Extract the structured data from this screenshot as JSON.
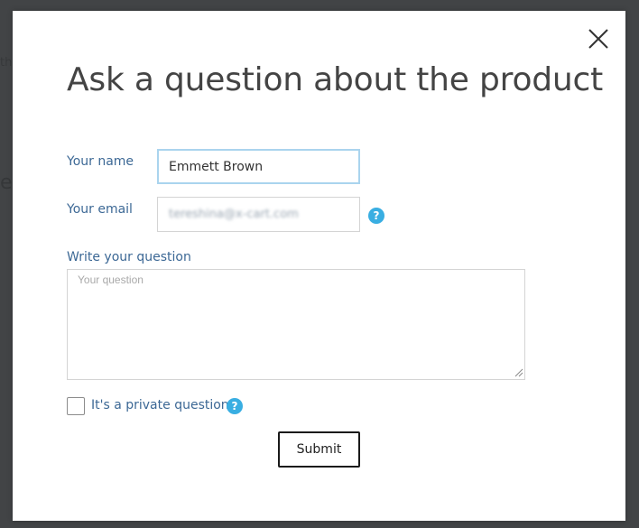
{
  "background": {
    "fragments": [
      "the",
      "ec"
    ]
  },
  "modal": {
    "title": "Ask a question about the product",
    "close_icon": "close-icon",
    "form": {
      "name_label": "Your name",
      "name_value": "Emmett Brown",
      "email_label": "Your email",
      "email_value": "tereshina@x-cart.com",
      "email_help_icon": "question-circle-icon",
      "question_label": "Write your question",
      "question_placeholder": "Your question",
      "question_value": "",
      "private_label": "It's a private question",
      "private_checked": false,
      "private_help_icon": "question-circle-icon",
      "help_glyph": "?",
      "submit_label": "Submit"
    }
  },
  "colors": {
    "label": "#3c6895",
    "help_icon": "#39aee2",
    "focus_border": "#aad4ee",
    "overlay": "#3f4244",
    "title": "#444444"
  }
}
